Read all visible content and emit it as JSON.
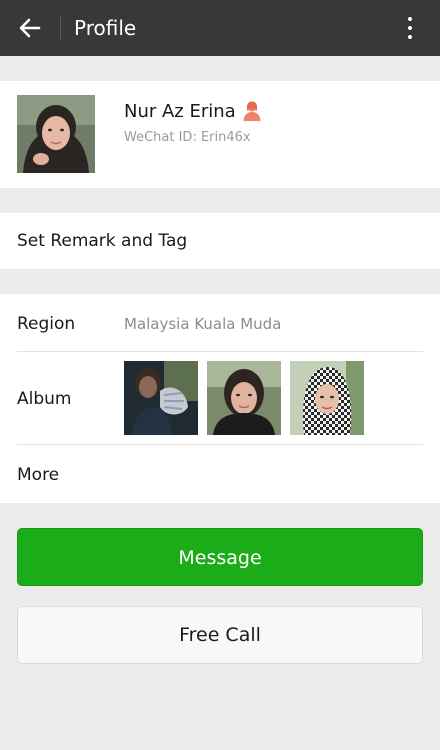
{
  "header": {
    "title": "Profile",
    "back_icon": "arrow-left-icon",
    "menu_icon": "more-vertical-icon"
  },
  "profile": {
    "name": "Nur Az Erina",
    "wechat_id": "WeChat ID: Erin46x",
    "gender_icon": "female-user-icon"
  },
  "remark": {
    "label": "Set Remark and Tag"
  },
  "details": {
    "region_label": "Region",
    "region_value": "Malaysia  Kuala Muda",
    "album_label": "Album",
    "more_label": "More"
  },
  "actions": {
    "message_label": "Message",
    "free_call_label": "Free Call"
  },
  "colors": {
    "topbar": "#383838",
    "primary_green": "#1aad19",
    "background": "#ebebeb",
    "gender_icon": "#f0826a"
  }
}
